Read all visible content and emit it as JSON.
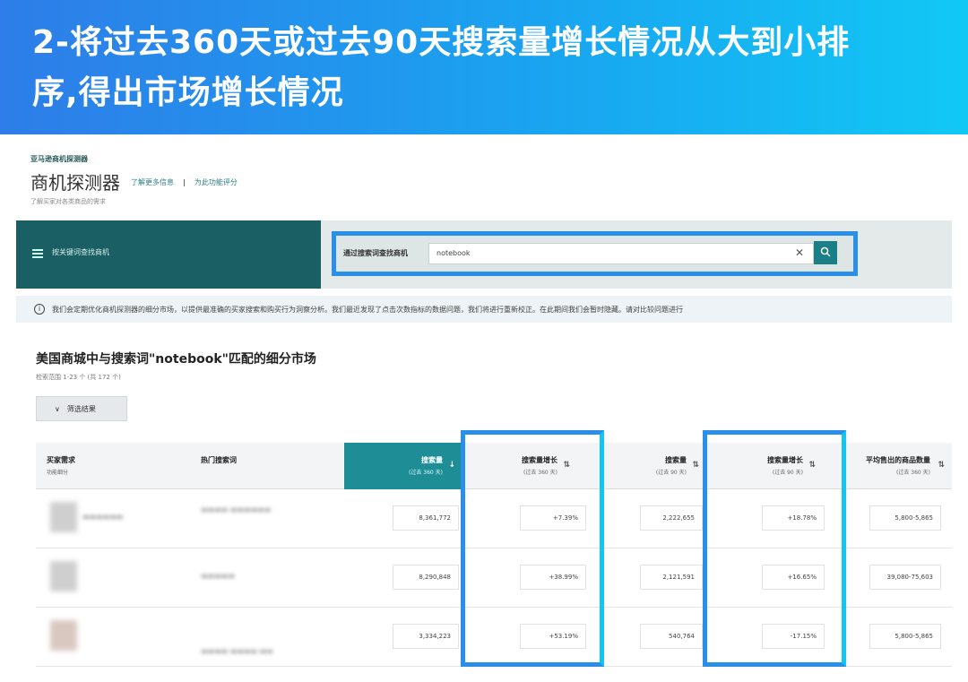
{
  "banner": {
    "line1": "2-将过去360天或过去90天搜索量增长情况从大到小排",
    "line2": "序,得出市场增长情况"
  },
  "app": {
    "breadcrumb": "亚马逊商机探测器",
    "title": "商机探测器",
    "link1": "了解更多信息",
    "link2": "为此功能评分",
    "subtitle": "了解买家对各类商品的需求"
  },
  "search_band": {
    "left_label": "按关键词查找商机",
    "search_label": "通过搜索词查找商机",
    "search_value": "notebook"
  },
  "info": {
    "text": "我们会定期优化商机探测器的细分市场，以提供最准确的买家搜索和购买行为洞察分析。我们最近发现了点击次数指标的数据问题，我们将进行重新校正。在此期间我们会暂时隐藏。请对比较问题进行"
  },
  "section": {
    "title": "美国商城中与搜索词\"notebook\"匹配的细分市场",
    "subtitle": "检索范围 1-23 个 (共 172 个)",
    "filter_label": "筛选结果"
  },
  "table": {
    "headers": [
      {
        "label": "买家需求",
        "sub": "功能细分"
      },
      {
        "label": "热门搜索词",
        "sub": ""
      },
      {
        "label": "搜索量",
        "sub": "(过去 360 天)"
      },
      {
        "label": "搜索量增长",
        "sub": "(过去 360 天)"
      },
      {
        "label": "搜索量",
        "sub": "(过去 90 天)"
      },
      {
        "label": "搜索量增长",
        "sub": "(过去 90 天)"
      },
      {
        "label": "平均售出的商品数量",
        "sub": "(过去 360 天)"
      }
    ],
    "rows": [
      {
        "search_360": "8,361,772",
        "growth_360": "+7.39%",
        "search_90": "2,222,655",
        "growth_90": "+18.78%",
        "units": "5,800-5,865"
      },
      {
        "search_360": "8,290,848",
        "growth_360": "+38.99%",
        "search_90": "2,121,591",
        "growth_90": "+16.65%",
        "units": "39,080-75,603"
      },
      {
        "search_360": "3,334,223",
        "growth_360": "+53.19%",
        "search_90": "540,764",
        "growth_90": "-17.15%",
        "units": "5,800-5,865"
      }
    ]
  },
  "colors": {
    "banner_start": "#2e7de8",
    "banner_end": "#11c8f5",
    "teal_dark": "#1a5f63",
    "teal_active": "#1f8d95",
    "highlight": "#2a8fe8"
  }
}
